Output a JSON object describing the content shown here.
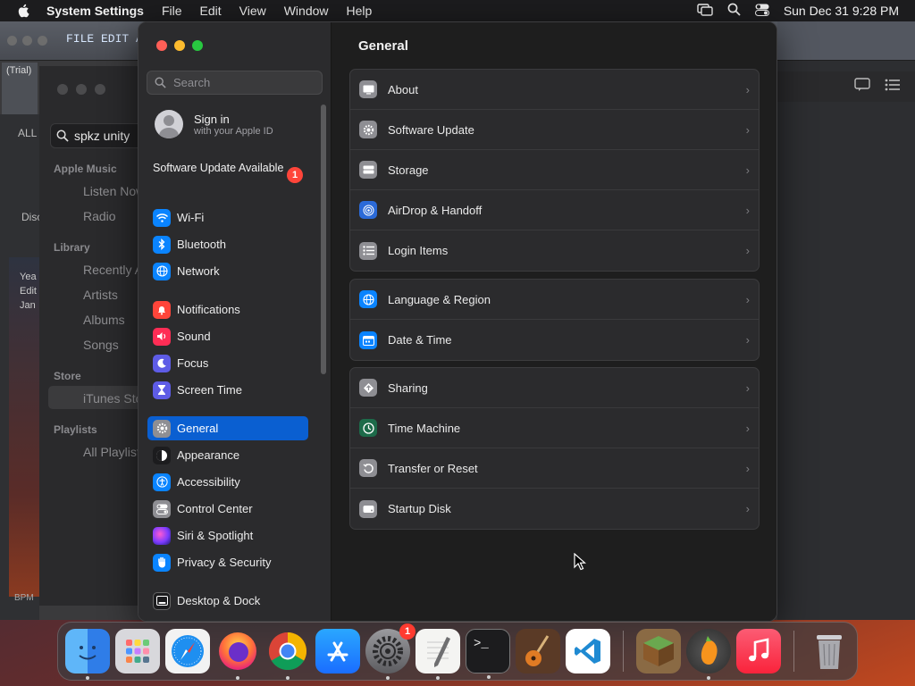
{
  "menubar": {
    "app_name": "System Settings",
    "items": [
      "File",
      "Edit",
      "View",
      "Window",
      "Help"
    ],
    "clock": "Sun Dec 31  9:28 PM"
  },
  "background_app": {
    "menus": "FILE EDIT ADD",
    "trial": "(Trial)",
    "bpm": "BPM"
  },
  "music": {
    "search_value": "spkz unity",
    "sections": {
      "apple_music": "Apple Music",
      "library": "Library",
      "store": "Store",
      "playlists": "Playlists"
    },
    "items": {
      "listen_now": "Listen Now",
      "radio": "Radio",
      "recently_added": "Recently A",
      "artists": "Artists",
      "albums": "Albums",
      "songs": "Songs",
      "itunes_store": "iTunes Sto",
      "all_playlists": "All Playlists"
    },
    "left_strip": {
      "all": "ALL",
      "disc": "Disc",
      "line1": "Yea",
      "line2": "Edit",
      "line3": "Jan"
    }
  },
  "sidebar": {
    "search_placeholder": "Search",
    "signin_title": "Sign in",
    "signin_subtitle": "with your Apple ID",
    "update_text": "Software Update Available",
    "update_badge": "1",
    "items": [
      {
        "label": "Wi-Fi",
        "icon": "wifi-icon",
        "color": "#0a84ff"
      },
      {
        "label": "Bluetooth",
        "icon": "bluetooth-icon",
        "color": "#0a84ff"
      },
      {
        "label": "Network",
        "icon": "globe-icon",
        "color": "#0a84ff"
      },
      {
        "label": "Notifications",
        "icon": "bell-icon",
        "color": "#ff453a"
      },
      {
        "label": "Sound",
        "icon": "speaker-icon",
        "color": "#ff2d55"
      },
      {
        "label": "Focus",
        "icon": "moon-icon",
        "color": "#5e5ce6"
      },
      {
        "label": "Screen Time",
        "icon": "hourglass-icon",
        "color": "#5e5ce6"
      },
      {
        "label": "General",
        "icon": "gear-icon",
        "color": "#8e8e93"
      },
      {
        "label": "Appearance",
        "icon": "appearance-icon",
        "color": "#1c1c1e"
      },
      {
        "label": "Accessibility",
        "icon": "accessibility-icon",
        "color": "#0a84ff"
      },
      {
        "label": "Control Center",
        "icon": "control-center-icon",
        "color": "#8e8e93"
      },
      {
        "label": "Siri & Spotlight",
        "icon": "siri-icon",
        "color": "#bf5af2"
      },
      {
        "label": "Privacy & Security",
        "icon": "hand-icon",
        "color": "#0a84ff"
      },
      {
        "label": "Desktop & Dock",
        "icon": "dock-icon",
        "color": "#1c1c1e"
      }
    ],
    "active": "General"
  },
  "content": {
    "title": "General",
    "groups": [
      [
        {
          "label": "About",
          "icon": "about-icon"
        },
        {
          "label": "Software Update",
          "icon": "software-update-icon"
        },
        {
          "label": "Storage",
          "icon": "storage-icon"
        },
        {
          "label": "AirDrop & Handoff",
          "icon": "airdrop-icon"
        },
        {
          "label": "Login Items",
          "icon": "list-icon"
        }
      ],
      [
        {
          "label": "Language & Region",
          "icon": "globe-icon"
        },
        {
          "label": "Date & Time",
          "icon": "calendar-icon"
        }
      ],
      [
        {
          "label": "Sharing",
          "icon": "sharing-icon"
        },
        {
          "label": "Time Machine",
          "icon": "time-machine-icon"
        },
        {
          "label": "Transfer or Reset",
          "icon": "reset-icon"
        },
        {
          "label": "Startup Disk",
          "icon": "disk-icon"
        }
      ]
    ]
  },
  "dock": {
    "apps": [
      {
        "name": "Finder",
        "icon": "finder-icon",
        "color": "#2f8ef3",
        "running": true
      },
      {
        "name": "Launchpad",
        "icon": "launchpad-icon",
        "color": "#d8d8dc",
        "running": false
      },
      {
        "name": "Safari",
        "icon": "safari-icon",
        "color": "#1e8ff0",
        "running": false
      },
      {
        "name": "Firefox",
        "icon": "firefox-icon",
        "color": "#f56a2a",
        "running": true
      },
      {
        "name": "Chrome",
        "icon": "chrome-icon",
        "color": "#ffffff",
        "running": true
      },
      {
        "name": "App Store",
        "icon": "app-store-icon",
        "color": "#1a8cff",
        "running": false
      },
      {
        "name": "System Settings",
        "icon": "system-settings-icon",
        "color": "#8e8e93",
        "running": true,
        "badge": "1"
      },
      {
        "name": "TextEdit",
        "icon": "textedit-icon",
        "color": "#f2f2f2",
        "running": true
      },
      {
        "name": "Terminal",
        "icon": "terminal-icon",
        "color": "#1c1c1e",
        "running": true
      },
      {
        "name": "GarageBand",
        "icon": "guitar-icon",
        "color": "#3a2a22",
        "running": false
      },
      {
        "name": "Visual Studio Code",
        "icon": "vscode-icon",
        "color": "#ffffff",
        "running": false
      },
      {
        "name": "Minecraft",
        "icon": "minecraft-icon",
        "color": "#6aa84f",
        "running": false
      },
      {
        "name": "FL Studio",
        "icon": "fl-studio-icon",
        "color": "#3a3a3a",
        "running": true
      },
      {
        "name": "Music",
        "icon": "music-icon",
        "color": "#fa2d48",
        "running": false
      },
      {
        "name": "Trash",
        "icon": "trash-icon",
        "color": "#9a9a9e",
        "running": false
      }
    ]
  }
}
